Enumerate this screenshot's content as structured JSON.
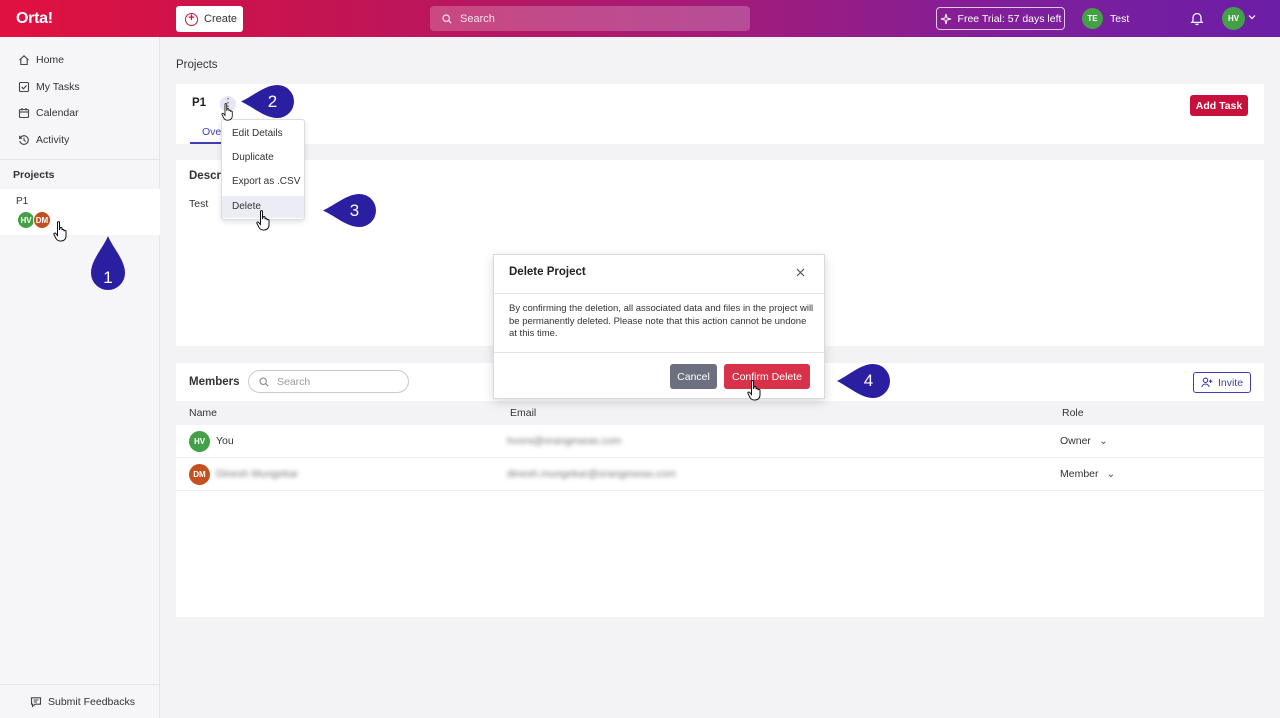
{
  "topbar": {
    "logo": "Orta!",
    "create_label": "Create",
    "search_placeholder": "Search",
    "trial_label": "Free Trial: 57 days left",
    "user_initials": "TE",
    "user_name": "Test",
    "avatar_initials": "HV"
  },
  "sidebar": {
    "items": [
      {
        "label": "Home",
        "icon": "home-icon"
      },
      {
        "label": "My Tasks",
        "icon": "checkbox-icon"
      },
      {
        "label": "Calendar",
        "icon": "calendar-icon"
      },
      {
        "label": "Activity",
        "icon": "history-icon"
      }
    ],
    "projects_heading": "Projects",
    "project": {
      "name": "P1",
      "members": [
        "HV",
        "DM"
      ]
    },
    "feedback_label": "Submit Feedbacks"
  },
  "main": {
    "page_title": "Projects",
    "project_name": "P1",
    "tab_label": "Ove",
    "add_task_label": "Add Task",
    "description_title": "Descri",
    "description_text": "Test"
  },
  "dropdown": {
    "items": [
      "Edit Details",
      "Duplicate",
      "Export as .CSV",
      "Delete"
    ],
    "active": "Delete"
  },
  "members": {
    "title": "Members",
    "search_placeholder": "Search",
    "invite_label": "Invite",
    "columns": [
      "Name",
      "Email",
      "Role"
    ],
    "rows": [
      {
        "initials": "HV",
        "name": "You",
        "email": "hvora@orangeseas.com",
        "role": "Owner",
        "avatar_color": "#43a047"
      },
      {
        "initials": "DM",
        "name": "Dinesh Mungekar",
        "email": "dinesh.mungekar@orangeseas.com",
        "role": "Member",
        "avatar_color": "#c4501e"
      }
    ]
  },
  "modal": {
    "title": "Delete Project",
    "body": "By confirming the deletion, all associated data and files in the project will be permanently deleted. Please note that this action cannot be undone at this time.",
    "cancel_label": "Cancel",
    "confirm_label": "Confirm Delete"
  },
  "markers": [
    "1",
    "2",
    "3",
    "4"
  ],
  "colors": {
    "brand_red": "#c8103c",
    "accent_blue": "#3f3fb4",
    "marker_blue": "#2a1fa0",
    "confirm_red": "#d8324a",
    "cancel_gray": "#6b6f80"
  }
}
